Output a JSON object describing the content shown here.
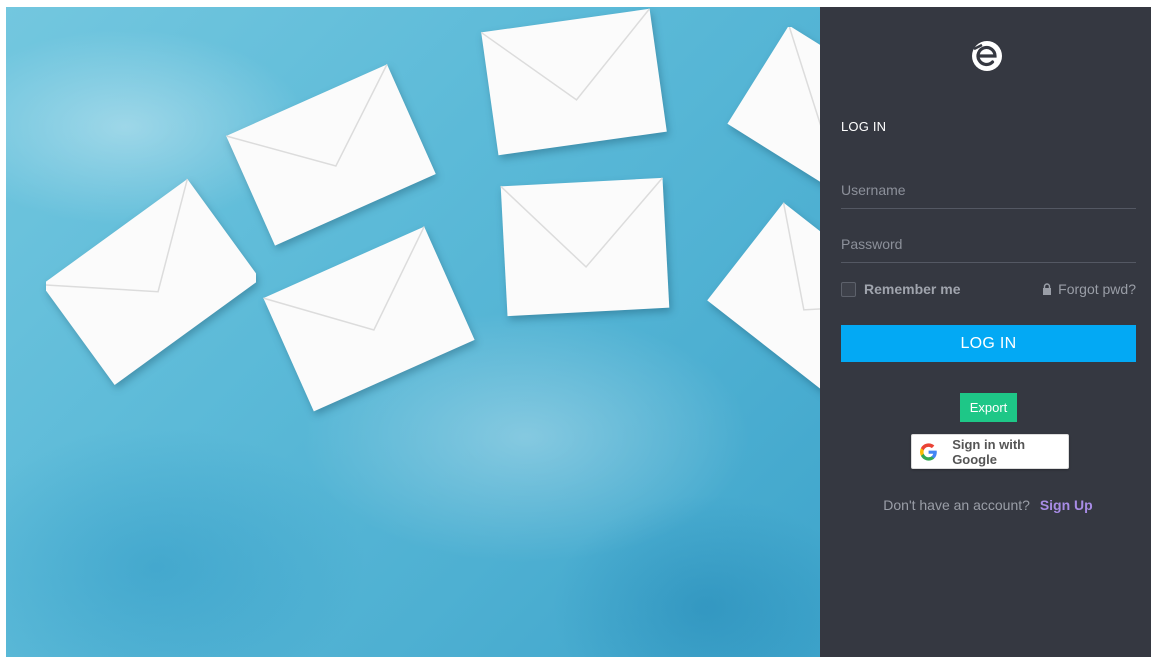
{
  "hero": {
    "description_icon": "envelope-icon",
    "background_color": "#5cbad8"
  },
  "panel": {
    "background_color": "#353841",
    "logo_icon": "brand-e-logo-icon",
    "section_title": "LOG IN",
    "username": {
      "placeholder": "Username",
      "value": ""
    },
    "password": {
      "placeholder": "Password",
      "value": ""
    },
    "remember_label": "Remember me",
    "remember_checked": false,
    "forgot_label": "Forgot pwd?",
    "forgot_icon": "lock-icon",
    "login_button_label": "LOG IN",
    "login_button_color": "#03a9f4",
    "export_button_label": "Export",
    "export_button_color": "#1ec787",
    "google_button_label": "Sign in with Google",
    "google_icon": "google-g-icon",
    "signup_prompt": "Don't have an account?",
    "signup_link": "Sign Up",
    "signup_link_color": "#a88ce6"
  }
}
